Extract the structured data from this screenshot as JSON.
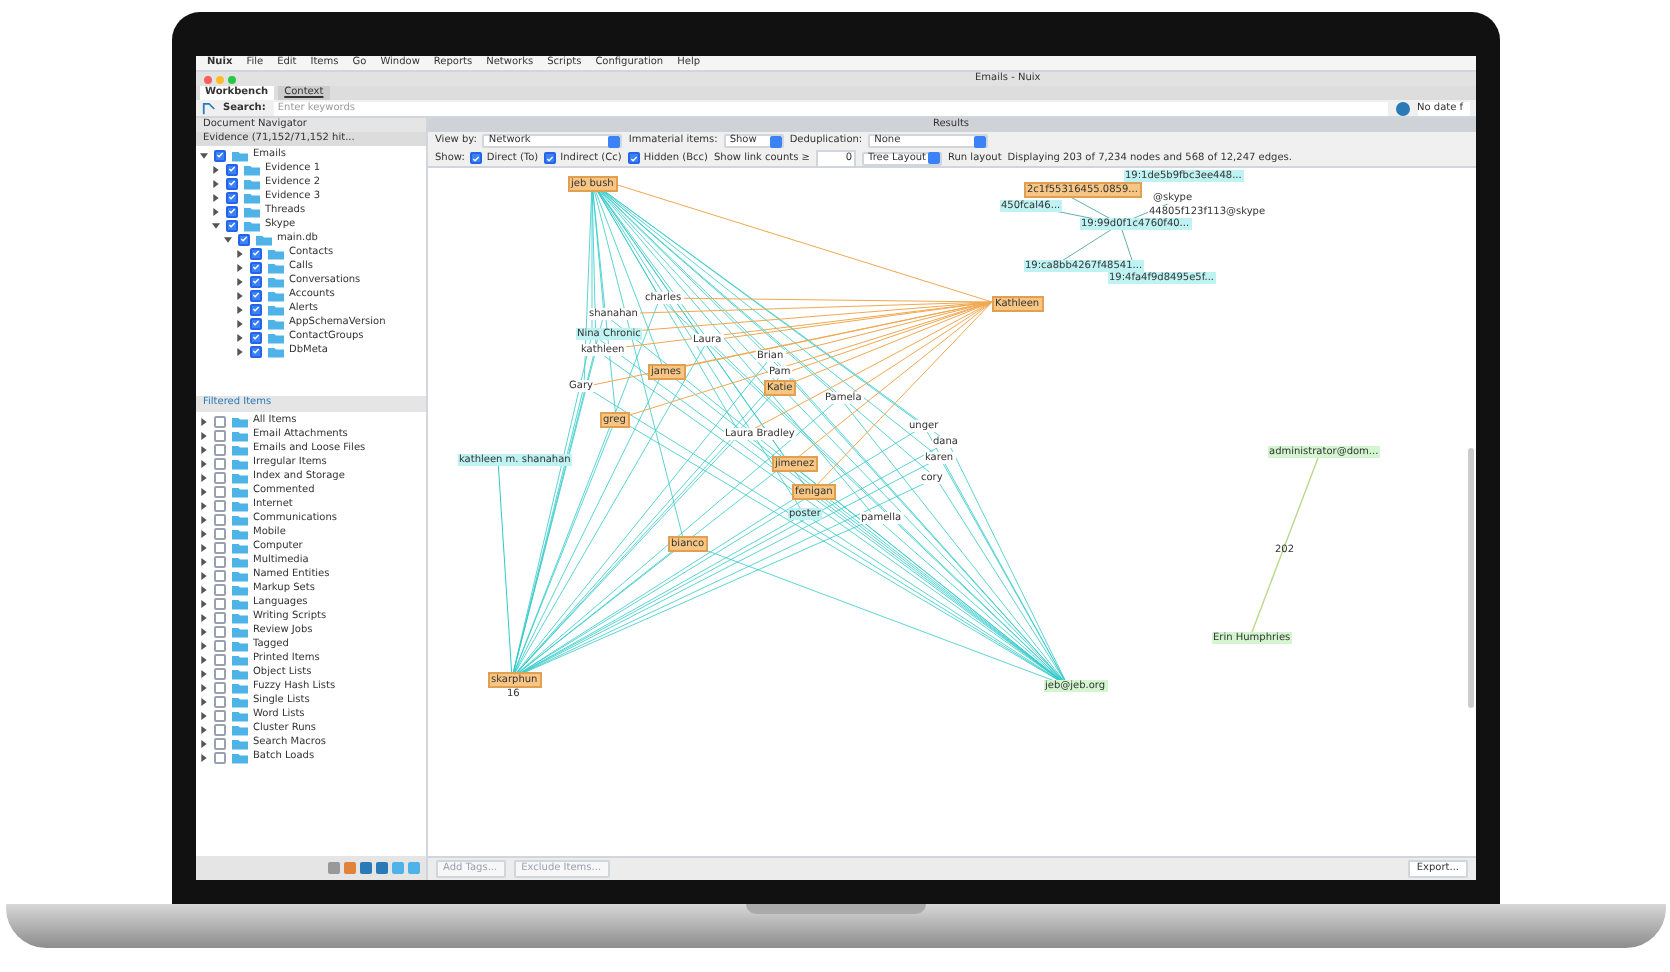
{
  "menu_bar": [
    "Nuix",
    "File",
    "Edit",
    "Items",
    "Go",
    "Window",
    "Reports",
    "Networks",
    "Scripts",
    "Configuration",
    "Help"
  ],
  "window": {
    "title": "Emails - Nuix"
  },
  "tabs": [
    {
      "label": "Workbench",
      "selected": true
    },
    {
      "label": "Context",
      "selected": false
    }
  ],
  "search": {
    "label": "Search:",
    "placeholder": "Enter keywords",
    "date_filter": "No date f"
  },
  "navigator": {
    "title": "Document Navigator",
    "evidence": "Evidence (71,152/71,152 hit...",
    "tree": [
      {
        "label": "Emails",
        "checked": true,
        "expanded": true,
        "children": [
          {
            "label": "Evidence 1",
            "checked": true,
            "expanded": false
          },
          {
            "label": "Evidence 2",
            "checked": true,
            "expanded": false
          },
          {
            "label": "Evidence 3",
            "checked": true,
            "expanded": false
          },
          {
            "label": "Threads",
            "checked": true,
            "expanded": false
          },
          {
            "label": "Skype",
            "checked": true,
            "expanded": true,
            "children": [
              {
                "label": "main.db",
                "checked": true,
                "expanded": true,
                "children": [
                  {
                    "label": "Contacts",
                    "checked": true,
                    "expanded": false
                  },
                  {
                    "label": "Calls",
                    "checked": true,
                    "expanded": false
                  },
                  {
                    "label": "Conversations",
                    "checked": true,
                    "expanded": false
                  },
                  {
                    "label": "Accounts",
                    "checked": true,
                    "expanded": false
                  },
                  {
                    "label": "Alerts",
                    "checked": true,
                    "expanded": false
                  },
                  {
                    "label": "AppSchemaVersion",
                    "checked": true,
                    "expanded": false
                  },
                  {
                    "label": "ContactGroups",
                    "checked": true,
                    "expanded": false
                  },
                  {
                    "label": "DbMeta",
                    "checked": true,
                    "expanded": false
                  }
                ]
              }
            ]
          }
        ]
      }
    ]
  },
  "filtered_items": {
    "title": "Filtered Items",
    "items": [
      {
        "label": "All Items",
        "checked": false
      },
      {
        "label": "Email Attachments",
        "checked": false
      },
      {
        "label": "Emails and Loose Files",
        "checked": false
      },
      {
        "label": "Irregular Items",
        "checked": false
      },
      {
        "label": "Index and Storage",
        "checked": false
      },
      {
        "label": "Commented",
        "checked": false
      },
      {
        "label": "Internet",
        "checked": false
      },
      {
        "label": "Communications",
        "checked": false
      },
      {
        "label": "Mobile",
        "checked": false
      },
      {
        "label": "Computer",
        "checked": false
      },
      {
        "label": "Multimedia",
        "checked": false
      },
      {
        "label": "Named Entities",
        "checked": false
      },
      {
        "label": "Markup Sets",
        "checked": false
      },
      {
        "label": "Languages",
        "checked": false
      },
      {
        "label": "Writing Scripts",
        "checked": false
      },
      {
        "label": "Review Jobs",
        "checked": false
      },
      {
        "label": "Tagged",
        "checked": false
      },
      {
        "label": "Printed Items",
        "checked": false
      },
      {
        "label": "Object Lists",
        "checked": false
      },
      {
        "label": "Fuzzy Hash Lists",
        "checked": false
      },
      {
        "label": "Single Lists",
        "checked": false
      },
      {
        "label": "Word Lists",
        "checked": false
      },
      {
        "label": "Cluster Runs",
        "checked": false
      },
      {
        "label": "Search Macros",
        "checked": false
      },
      {
        "label": "Batch Loads",
        "checked": false
      }
    ]
  },
  "results": {
    "title": "Results",
    "view_by": {
      "label": "View by:",
      "value": "Network"
    },
    "immaterial": {
      "label": "Immaterial items:",
      "value": "Show"
    },
    "dedup": {
      "label": "Deduplication:",
      "value": "None"
    },
    "show_label": "Show:",
    "filters": [
      {
        "label": "Direct (To)",
        "checked": true
      },
      {
        "label": "Indirect (Cc)",
        "checked": true
      },
      {
        "label": "Hidden (Bcc)",
        "checked": true
      }
    ],
    "link_count": {
      "label": "Show link counts ≥",
      "value": "0"
    },
    "layout": "Tree Layout",
    "run_layout": "Run layout",
    "summary": "Displaying 203 of 7,234 nodes and 568 of 12,247 edges.",
    "nodes": [
      {
        "label": "jeb bush",
        "kind": "person"
      },
      {
        "label": "Kathleen",
        "kind": "person"
      },
      {
        "label": "kathleen m. shanahan",
        "kind": "address"
      },
      {
        "label": "skarphun",
        "kind": "person"
      },
      {
        "label": "jeb@jeb.org",
        "kind": "external"
      },
      {
        "label": "administrator@dom...",
        "kind": "external"
      },
      {
        "label": "Erin Humphries",
        "kind": "external"
      },
      {
        "label": "19:1de5b9fbc3ee448...",
        "kind": "address"
      },
      {
        "label": "2c1f55316455.0859...",
        "kind": "person"
      },
      {
        "label": "@skype",
        "kind": "plain"
      },
      {
        "label": "450fcal46...",
        "kind": "address"
      },
      {
        "label": "44805f123f113@skype",
        "kind": "plain"
      },
      {
        "label": "19:99d0f1c4760f40...",
        "kind": "address"
      },
      {
        "label": "19:ca8bb4267f48541...",
        "kind": "address"
      },
      {
        "label": "19:4fa4f9d8495e5f...",
        "kind": "address"
      },
      {
        "label": "charles",
        "kind": "plain"
      },
      {
        "label": "shanahan",
        "kind": "plain"
      },
      {
        "label": "Nina Chronic",
        "kind": "address"
      },
      {
        "label": "kathleen",
        "kind": "plain"
      },
      {
        "label": "Laura",
        "kind": "plain"
      },
      {
        "label": "Brian",
        "kind": "plain"
      },
      {
        "label": "Pam",
        "kind": "plain"
      },
      {
        "label": "Katie",
        "kind": "person"
      },
      {
        "label": "Pamela",
        "kind": "plain"
      },
      {
        "label": "james",
        "kind": "person"
      },
      {
        "label": "greg",
        "kind": "person"
      },
      {
        "label": "Gary",
        "kind": "plain"
      },
      {
        "label": "Laura Bradley",
        "kind": "plain"
      },
      {
        "label": "jimenez",
        "kind": "person"
      },
      {
        "label": "fenigan",
        "kind": "person"
      },
      {
        "label": "unger",
        "kind": "plain"
      },
      {
        "label": "dana",
        "kind": "plain"
      },
      {
        "label": "karen",
        "kind": "plain"
      },
      {
        "label": "cory",
        "kind": "plain"
      },
      {
        "label": "poster",
        "kind": "address"
      },
      {
        "label": "pamella",
        "kind": "plain"
      },
      {
        "label": "bianco",
        "kind": "person"
      }
    ],
    "edge_counts": [
      "202",
      "16"
    ]
  },
  "actions": [
    {
      "label": "Add Tags..."
    },
    {
      "label": "Exclude Items..."
    }
  ],
  "export": "Export..."
}
